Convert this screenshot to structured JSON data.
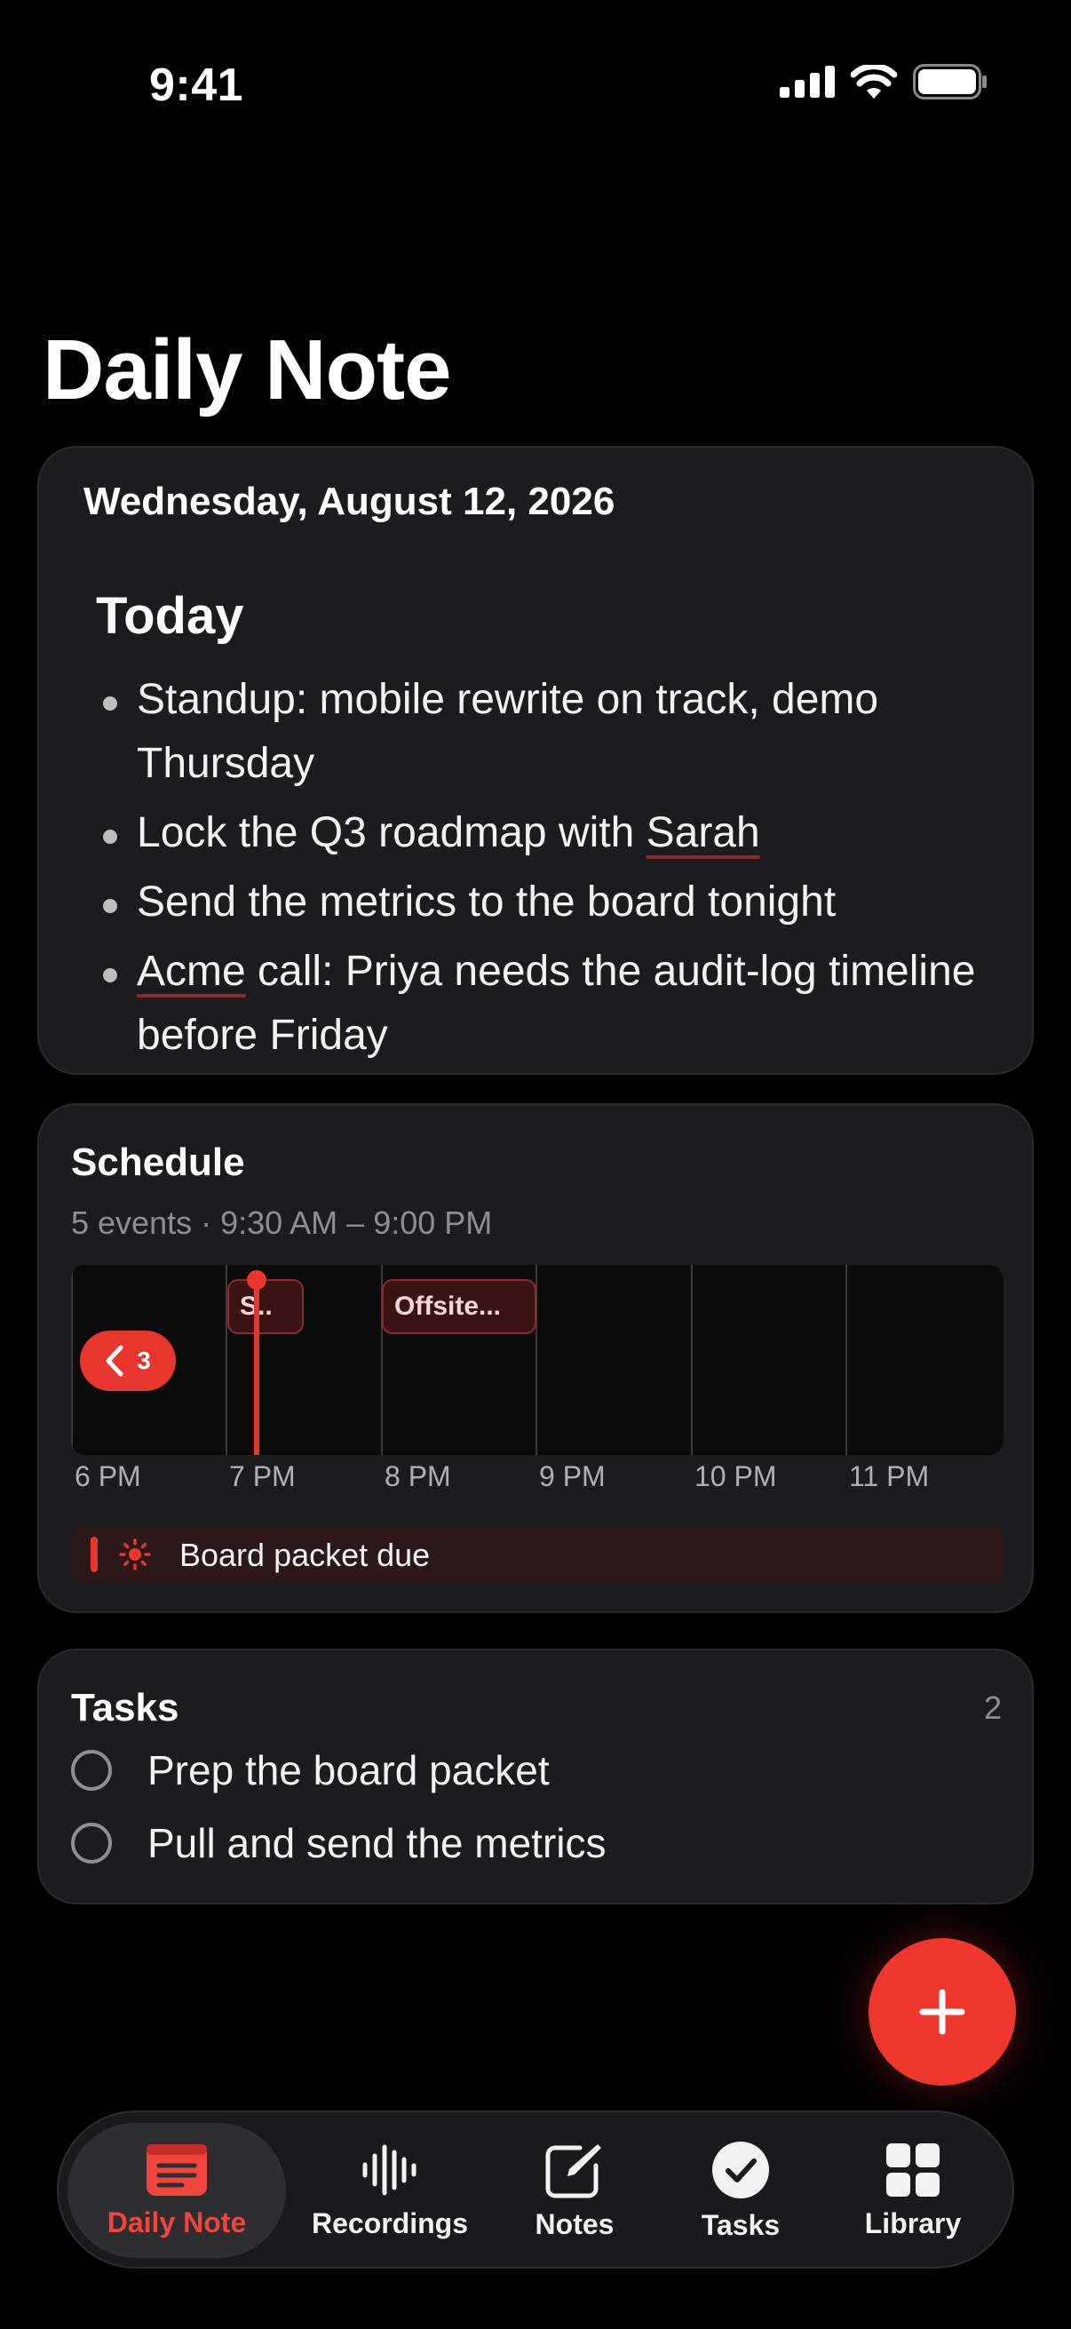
{
  "status_bar": {
    "time": "9:41"
  },
  "page_title": "Daily Note",
  "note": {
    "date": "Wednesday, August 12, 2026",
    "heading": "Today",
    "bullets": [
      "Standup: mobile rewrite on track, demo Thursday",
      "Lock the Q3 roadmap with Sarah",
      "Send the metrics to the board tonight",
      "Acme call: Priya needs the audit-log timeline before Friday"
    ]
  },
  "schedule": {
    "title": "Schedule",
    "subtitle": "5 events · 9:30 AM – 9:00 PM",
    "hours": [
      "6 PM",
      "7 PM",
      "8 PM",
      "9 PM",
      "10 PM",
      "11 PM"
    ],
    "events": [
      {
        "label": "S.."
      },
      {
        "label": "Offsite..."
      }
    ],
    "more_count": "3",
    "all_day": {
      "label": "Board packet due",
      "icon": "sun-icon"
    },
    "accent": "#e8352d"
  },
  "tasks": {
    "title": "Tasks",
    "count": "2",
    "items": [
      "Prep the board packet",
      "Pull and send the metrics"
    ]
  },
  "fab": {
    "icon": "plus-icon"
  },
  "tabbar": {
    "items": [
      {
        "label": "Daily Note",
        "icon": "daily-note-icon",
        "active": true
      },
      {
        "label": "Recordings",
        "icon": "waveform-icon"
      },
      {
        "label": "Notes",
        "icon": "compose-icon"
      },
      {
        "label": "Tasks",
        "icon": "checkmark-circle-icon"
      },
      {
        "label": "Library",
        "icon": "grid-icon"
      }
    ]
  }
}
